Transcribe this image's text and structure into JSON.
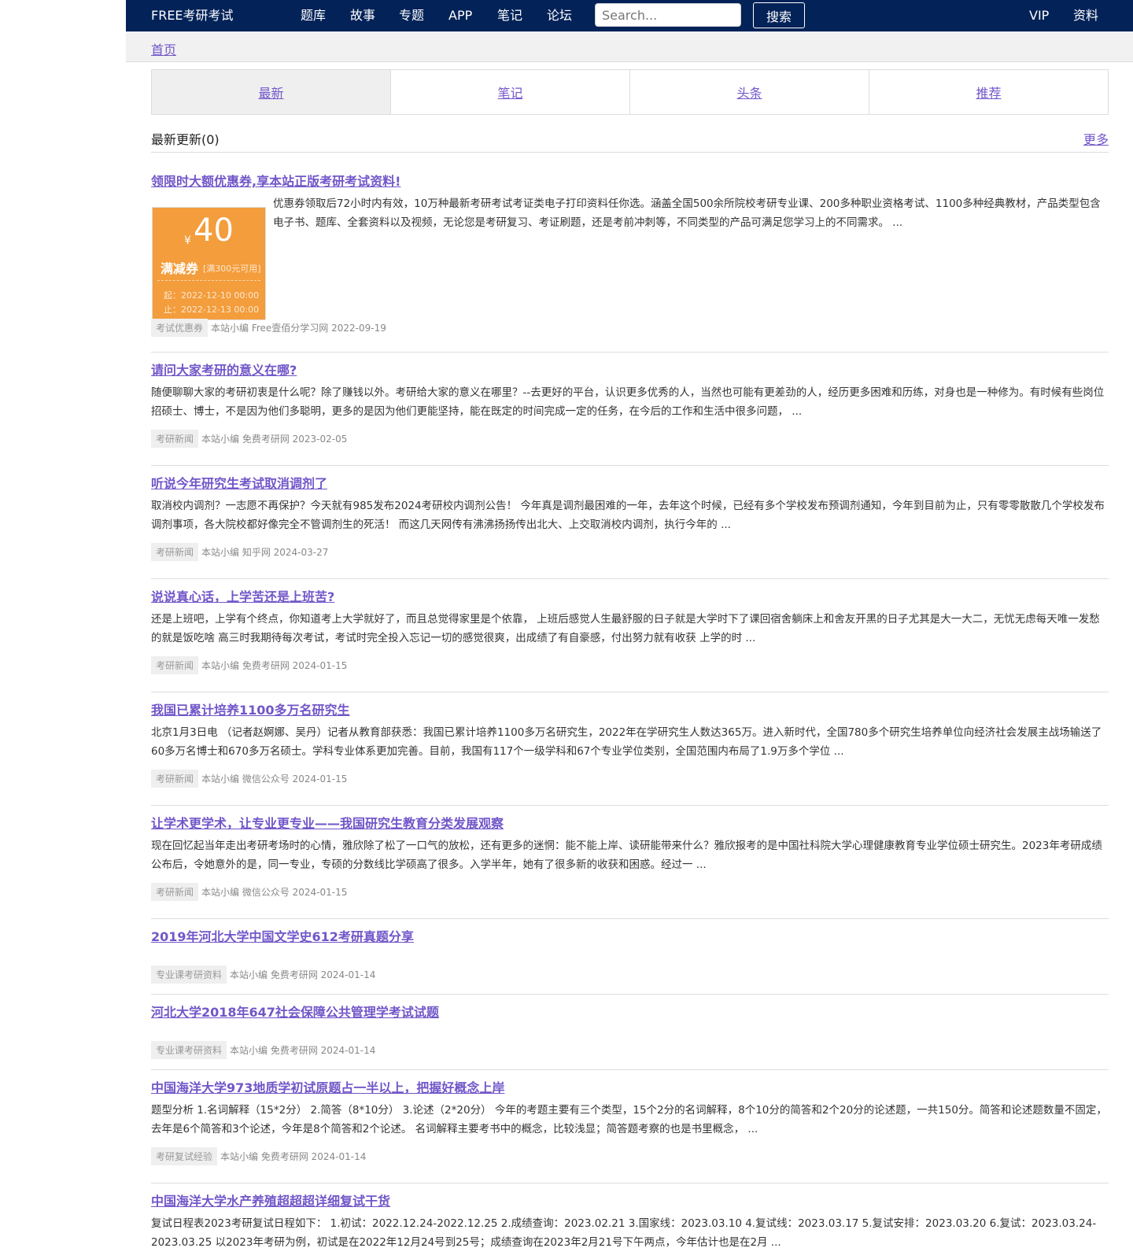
{
  "header": {
    "brand": "FREE考研考试",
    "nav": [
      "题库",
      "故事",
      "专题",
      "APP",
      "笔记",
      "论坛"
    ],
    "search_placeholder": "Search...",
    "search_button": "搜索",
    "right_nav": [
      "VIP",
      "资料"
    ]
  },
  "breadcrumb": {
    "home": "首页"
  },
  "tabs": [
    "最新",
    "笔记",
    "头条",
    "推荐"
  ],
  "section": {
    "title": "最新更新(0)",
    "more": "更多"
  },
  "coupon": {
    "currency": "¥",
    "amount": "40",
    "type": "满减券",
    "condition": "[满300元可用]",
    "start": "起：2022-12-10 00:00",
    "end": "止：2022-12-13 00:00"
  },
  "articles": [
    {
      "title": "领限时大额优惠券,享本站正版考研考试资料!",
      "summary": "优惠券领取后72小时内有效，10万种最新考研考试考证类电子打印资料任你选。涵盖全国500余所院校考研专业课、200多种职业资格考试、1100多种经典教材，产品类型包含电子书、题库、全套资料以及视频，无论您是考研复习、考证刷题，还是考前冲刺等，不同类型的产品可满足您学习上的不同需求。 ...",
      "tag": "考试优惠券",
      "meta": "本站小编 Free壹佰分学习网 2022-09-19"
    },
    {
      "title": "请问大家考研的意义在哪?",
      "summary": "随便聊聊大家的考研初衷是什么呢？除了赚钱以外。考研给大家的意义在哪里？--去更好的平台，认识更多优秀的人，当然也可能有更差劲的人，经历更多困难和历练，对身也是一种修为。有时候有些岗位招硕士、博士，不是因为他们多聪明，更多的是因为他们更能坚持，能在既定的时间完成一定的任务，在今后的工作和生活中很多问题， ...",
      "tag": "考研新闻",
      "meta": "本站小编 免费考研网 2023-02-05"
    },
    {
      "title": "听说今年研究生考试取消调剂了",
      "summary": "取消校内调剂？一志愿不再保护？今天就有985发布2024考研校内调剂公告！ 今年真是调剂最困难的一年，去年这个时候，已经有多个学校发布预调剂通知，今年到目前为止，只有零零散散几个学校发布调剂事项，各大院校都好像完全不管调剂生的死活！ 而这几天网传有沸沸扬扬传出北大、上交取消校内调剂，执行今年的 ...",
      "tag": "考研新闻",
      "meta": "本站小编 知乎网 2024-03-27"
    },
    {
      "title": "说说真心话，上学苦还是上班苦?",
      "summary": "还是上班吧，上学有个终点，你知道考上大学就好了，而且总觉得家里是个依靠， 上班后感觉人生最舒服的日子就是大学时下了课回宿舍躺床上和舍友开黑的日子尤其是大一大二，无忧无虑每天唯一发愁的就是饭吃啥 高三时我期待每次考试，考试时完全投入忘记一切的感觉很爽，出成绩了有自豪感，付出努力就有收获 上学的时 ...",
      "tag": "考研新闻",
      "meta": "本站小编 免费考研网 2024-01-15"
    },
    {
      "title": "我国已累计培养1100多万名研究生",
      "summary": "北京1月3日电 （记者赵婀娜、吴丹）记者从教育部获悉：我国已累计培养1100多万名研究生，2022年在学研究生人数达365万。进入新时代，全国780多个研究生培养单位向经济社会发展主战场输送了60多万名博士和670多万名硕士。学科专业体系更加完善。目前，我国有117个一级学科和67个专业学位类别，全国范围内布局了1.9万多个学位 ...",
      "tag": "考研新闻",
      "meta": "本站小编 微信公众号 2024-01-15"
    },
    {
      "title": "让学术更学术，让专业更专业——我国研究生教育分类发展观察",
      "summary": "现在回忆起当年走出考研考场时的心情，雅欣除了松了一口气的放松，还有更多的迷惘：能不能上岸、读研能带来什么？雅欣报考的是中国社科院大学心理健康教育专业学位硕士研究生。2023年考研成绩公布后，令她意外的是，同一专业，专硕的分数线比学硕高了很多。入学半年，她有了很多新的收获和困惑。经过一 ...",
      "tag": "考研新闻",
      "meta": "本站小编 微信公众号 2024-01-15"
    },
    {
      "title": "2019年河北大学中国文学史612考研真题分享",
      "summary": "",
      "tag": "专业课考研资料",
      "meta": "本站小编 免费考研网 2024-01-14"
    },
    {
      "title": "河北大学2018年647社会保障公共管理学考试试题",
      "summary": "",
      "tag": "专业课考研资料",
      "meta": "本站小编 免费考研网 2024-01-14"
    },
    {
      "title": "中国海洋大学973地质学初试原题占一半以上，把握好概念上岸",
      "summary": "题型分析 1.名词解释（15*2分） 2.简答（8*10分） 3.论述（2*20分） 今年的考题主要有三个类型，15个2分的名词解释，8个10分的简答和2个20分的论述题，一共150分。简答和论述题数量不固定，去年是6个简答和3个论述，今年是8个简答和2个论述。 名词解释主要考书中的概念，比较浅显；简答题考察的也是书里概念， ...",
      "tag": "考研复试经验",
      "meta": "本站小编 免费考研网 2024-01-14"
    },
    {
      "title": "中国海洋大学水产养殖超超超详细复试干货",
      "summary": "复试日程表2023考研复试日程如下： 1.初试：2022.12.24-2022.12.25 2.成绩查询：2023.02.21 3.国家线：2023.03.10 4.复试线：2023.03.17 5.复试安排：2023.03.20 6.复试：2023.03.24-2023.03.25 以2023年考研为例，初试是在2022年12月24号到25号；成绩查询在2023年2月21号下午两点，今年估计也是在2月 ...",
      "tag": "",
      "meta": ""
    }
  ]
}
